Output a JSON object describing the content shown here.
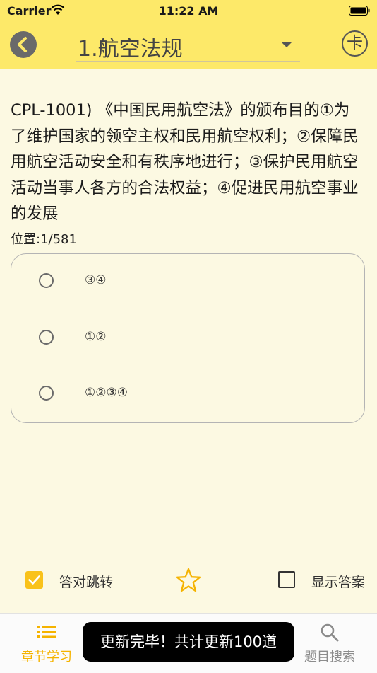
{
  "status_bar": {
    "carrier": "Carrier",
    "time": "11:22 AM"
  },
  "nav": {
    "chapter": "1.航空法规",
    "card_icon_label": "卡"
  },
  "question": {
    "text": "CPL-1001) 《中国民用航空法》的颁布目的①为了维护国家的领空主权和民用航空权利；②保障民用航空活动安全和有秩序地进行；③保护民用航空活动当事人各方的合法权益；④促进民用航空事业的发展",
    "position": "位置:1/581"
  },
  "options": [
    {
      "label": "③④"
    },
    {
      "label": "①②"
    },
    {
      "label": "①②③④"
    }
  ],
  "controls": {
    "auto_jump_label": "答对跳转",
    "auto_jump_checked": true,
    "show_answer_label": "显示答案",
    "show_answer_checked": false
  },
  "tabs": [
    {
      "label": "章节学习",
      "icon": "list-icon",
      "active": true
    },
    {
      "label": "题目搜索",
      "icon": "search-icon",
      "active": false
    }
  ],
  "toast": {
    "text": "更新完毕！共计更新100道"
  },
  "colors": {
    "accent": "#fde969",
    "checkbox": "#f9c21a",
    "tab_active": "#f5b300",
    "tab_inactive": "#8c8c8c",
    "background": "#fcf9e2"
  }
}
